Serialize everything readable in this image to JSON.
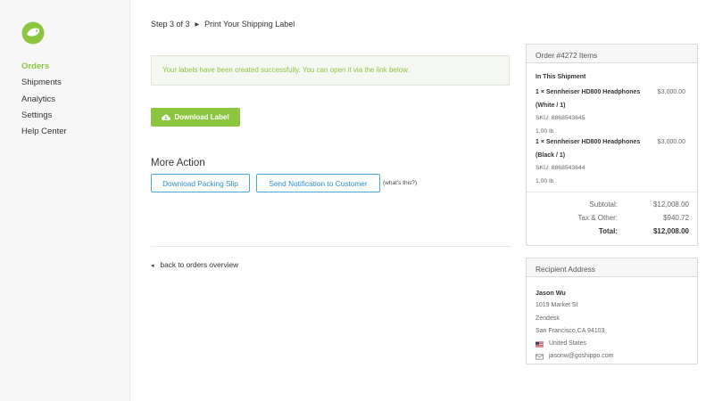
{
  "colors": {
    "brand_green": "#8cc63f",
    "link_blue": "#2f8fcb"
  },
  "sidebar": {
    "logo_icon": "leaf-logo-icon",
    "items": [
      {
        "label": "Orders",
        "active": true
      },
      {
        "label": "Shipments",
        "active": false
      },
      {
        "label": "Analytics",
        "active": false
      },
      {
        "label": "Settings",
        "active": false
      },
      {
        "label": "Help Center",
        "active": false
      }
    ]
  },
  "breadcrumb": {
    "step": "Step 3 of 3",
    "title": "Print Your Shipping Label"
  },
  "alert": {
    "message": "Your labels have been created successfully. You can open it via the link below."
  },
  "download": {
    "label": "Download Label",
    "icon": "cloud-download-icon"
  },
  "more_action": {
    "title": "More Action",
    "packing_slip": "Download Packing Slip",
    "notify": "Send Notification to Customer",
    "whats_this": "(what's this?)"
  },
  "back": {
    "label": "back to orders overview"
  },
  "order_items": {
    "header": "Order #4272 Items",
    "shipment_title": "In This Shipment",
    "items": [
      {
        "name": "1 × Sennheiser HD800 Headphones (White / 1)",
        "price": "$3,000.00",
        "sku": "SKU: 8868543645",
        "weight": "1.00 lb"
      },
      {
        "name": "1 × Sennheiser HD800 Headphones (Black / 1)",
        "price": "$3,000.00",
        "sku": "SKU: 8868543644",
        "weight": "1.00 lb"
      }
    ],
    "totals": {
      "subtotal_label": "Subtotal:",
      "subtotal": "$12,008.00",
      "tax_label": "Tax & Other:",
      "tax": "$940.72",
      "total_label": "Total:",
      "total": "$12,008.00"
    }
  },
  "recipient": {
    "header": "Recipient Address",
    "name": "Jason Wu",
    "street": "1019 Market St",
    "company": "Zendesk",
    "city": "San Francisco,CA 94103",
    "country": "United States",
    "email": "jasonw@goshippo.com",
    "flag_icon": "us-flag-icon",
    "email_icon": "envelope-icon"
  }
}
